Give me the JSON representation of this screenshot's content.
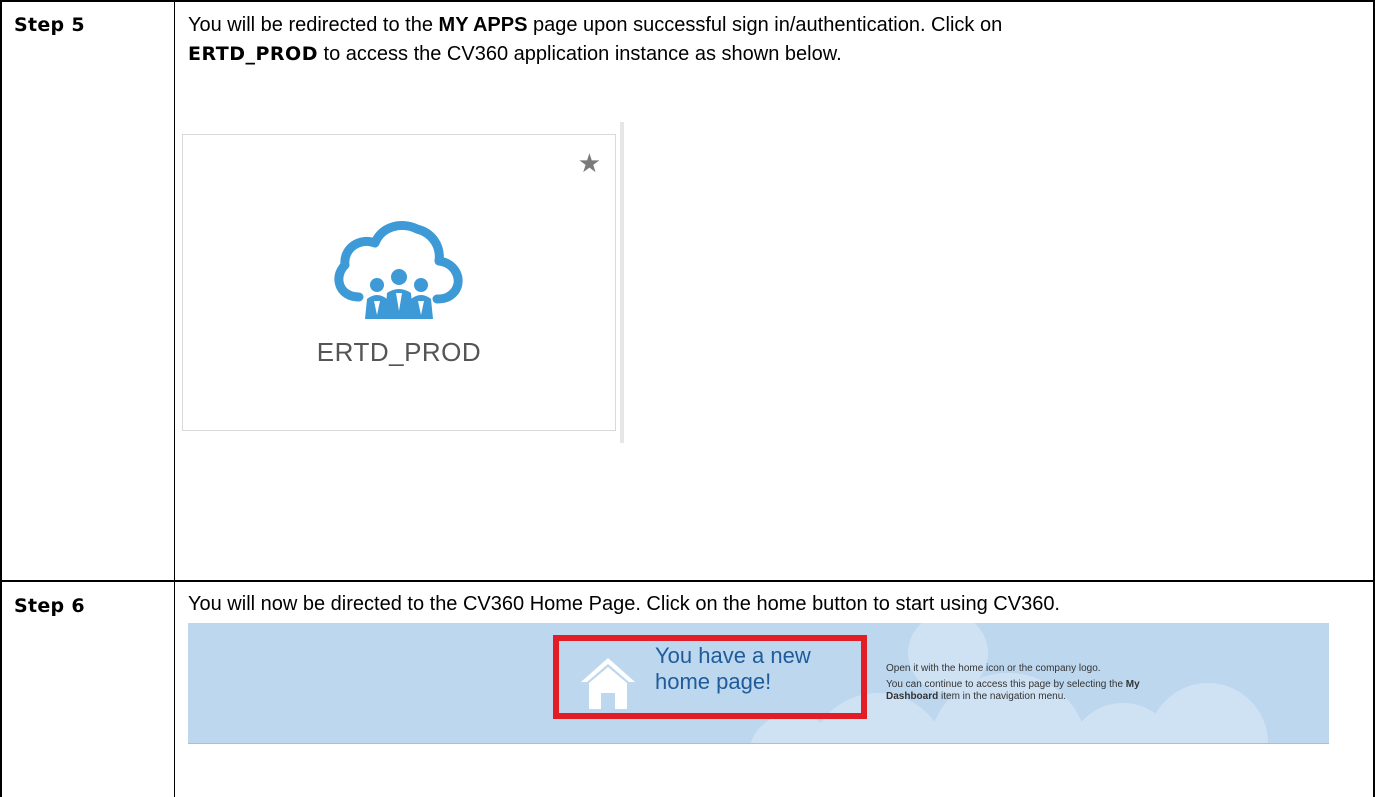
{
  "step5": {
    "label": "Step 5",
    "text_before_myapps": "You will be redirected to the ",
    "myapps_bold": "MY APPS",
    "text_after_myapps": " page upon successful sign in/authentication. Click on",
    "app_bold": "ERTD_PROD",
    "text_after_app": " to access the CV360 application instance as shown below."
  },
  "app_tile": {
    "name": "ERTD_PROD",
    "star_icon": "star-icon",
    "logo_icon": "cloud-people-icon"
  },
  "step6": {
    "label": "Step 6",
    "text": "You will now be directed to the CV360 Home Page. Click on the home button to start using CV360."
  },
  "banner": {
    "title": "You have a new home page!",
    "house_icon": "house-icon",
    "info_line1": "Open it with the home icon or the company logo.",
    "info_line2_before": "You can continue to access this page by selecting the ",
    "info_line2_bold1": "My",
    "info_line2_bold2": "Dashboard",
    "info_line2_after": " item in the navigation menu."
  },
  "colors": {
    "banner_bg": "#bdd7ee",
    "highlight": "#e31d25",
    "title_blue": "#1f5c99",
    "logo_blue": "#3d9ad6"
  }
}
